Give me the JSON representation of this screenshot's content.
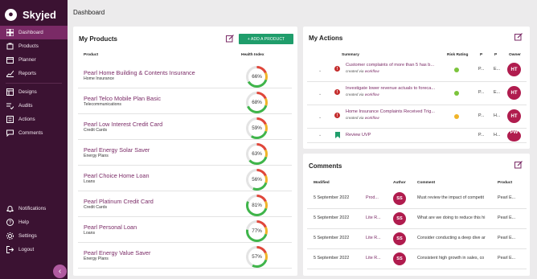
{
  "brand": {
    "name": "Skyjed"
  },
  "sidebar": {
    "items": [
      {
        "label": "Dashboard",
        "icon": "dashboard-icon"
      },
      {
        "label": "Products",
        "icon": "products-icon"
      },
      {
        "label": "Planner",
        "icon": "calendar-icon"
      },
      {
        "label": "Reports",
        "icon": "reports-icon"
      },
      {
        "label": "Designs",
        "icon": "designs-icon"
      },
      {
        "label": "Audits",
        "icon": "audits-icon"
      },
      {
        "label": "Actions",
        "icon": "actions-icon"
      },
      {
        "label": "Comments",
        "icon": "comments-icon"
      }
    ],
    "bottom_items": [
      {
        "label": "Notifications",
        "icon": "bell-icon"
      },
      {
        "label": "Help",
        "icon": "help-icon"
      },
      {
        "label": "Settings",
        "icon": "gear-icon"
      },
      {
        "label": "Logout",
        "icon": "logout-icon"
      }
    ],
    "collapse_glyph": "‹"
  },
  "header": {
    "title": "Dashboard"
  },
  "products": {
    "title": "My Products",
    "add_label": "+ ADD A PRODUCT",
    "col_product": "Product",
    "col_health": "Health Index",
    "rows": [
      {
        "name": "Pearl Home Building & Contents Insurance",
        "category": "Home Insurance",
        "health": "66%",
        "value": 66
      },
      {
        "name": "Pearl Telco Mobile Plan Basic",
        "category": "Telecommunications",
        "health": "68%",
        "value": 68
      },
      {
        "name": "Pearl Low Interest Credit Card",
        "category": "Credit Cards",
        "health": "59%",
        "value": 59
      },
      {
        "name": "Pearl Energy Solar Saver",
        "category": "Energy Plans",
        "health": "63%",
        "value": 63
      },
      {
        "name": "Pearl Choice Home Loan",
        "category": "Loans",
        "health": "56%",
        "value": 56
      },
      {
        "name": "Pearl Platinum Credit Card",
        "category": "Credit Cards",
        "health": "81%",
        "value": 81
      },
      {
        "name": "Pearl Personal Loan",
        "category": "Loans",
        "health": "77%",
        "value": 77
      },
      {
        "name": "Pearl Energy Value Saver",
        "category": "Energy Plans",
        "health": "57%",
        "value": 57
      }
    ]
  },
  "actions": {
    "title": "My Actions",
    "col_summary": "Summary",
    "col_risk": "Risk Rating",
    "col_p1": "P",
    "col_p2": "P",
    "col_owner": "Owner",
    "rows": [
      {
        "title": "Customer complaints of more than 5 has b...",
        "created": "created via",
        "source": "workflow",
        "risk_color": "#7cc43c",
        "p1": "P...",
        "p2": "E...",
        "owner": "HT",
        "flag": "!"
      },
      {
        "title": "Investigate lower revenue actuals to foreca...",
        "created": "created via",
        "source": "workflow",
        "risk_color": "#7cc43c",
        "p1": "P...",
        "p2": "E...",
        "owner": "HT",
        "flag": "!"
      },
      {
        "title": "Home Insurance Complaints Received Trig...",
        "created": "created via",
        "source": "workflow",
        "risk_color": "#f0b429",
        "p1": "P...",
        "p2": "H...",
        "owner": "HT",
        "flag": "!"
      },
      {
        "title": "Review UVP",
        "created": "",
        "source": "",
        "risk_color": "",
        "p1": "P...",
        "p2": "H...",
        "owner": "PW",
        "flag": ""
      }
    ]
  },
  "comments": {
    "title": "Comments",
    "col_modified": "Modified",
    "col_author": "Author",
    "col_comment": "Comment",
    "col_product": "Product",
    "rows": [
      {
        "date": "5 September 2022",
        "link": "Prod...",
        "author": "SS",
        "comment": "Must review the impact of competit",
        "product": "Pearl E..."
      },
      {
        "date": "5 September 2022",
        "link": "Lite R...",
        "author": "SS",
        "comment": "What are we doing to reduce this hi",
        "product": "Pearl E..."
      },
      {
        "date": "5 September 2022",
        "link": "Lite R...",
        "author": "SS",
        "comment": "Consider conducting a deep dive ar",
        "product": "Pearl E..."
      },
      {
        "date": "5 September 2022",
        "link": "Lite R...",
        "author": "SS",
        "comment": "Consistent high growth in sales, co",
        "product": "Pearl E..."
      }
    ]
  },
  "colors": {
    "sidebar": "#3b1232",
    "active": "#7a2a66",
    "accent_green": "#1f9d6b",
    "link": "#7a2a66",
    "badge": "#b01c4e"
  }
}
